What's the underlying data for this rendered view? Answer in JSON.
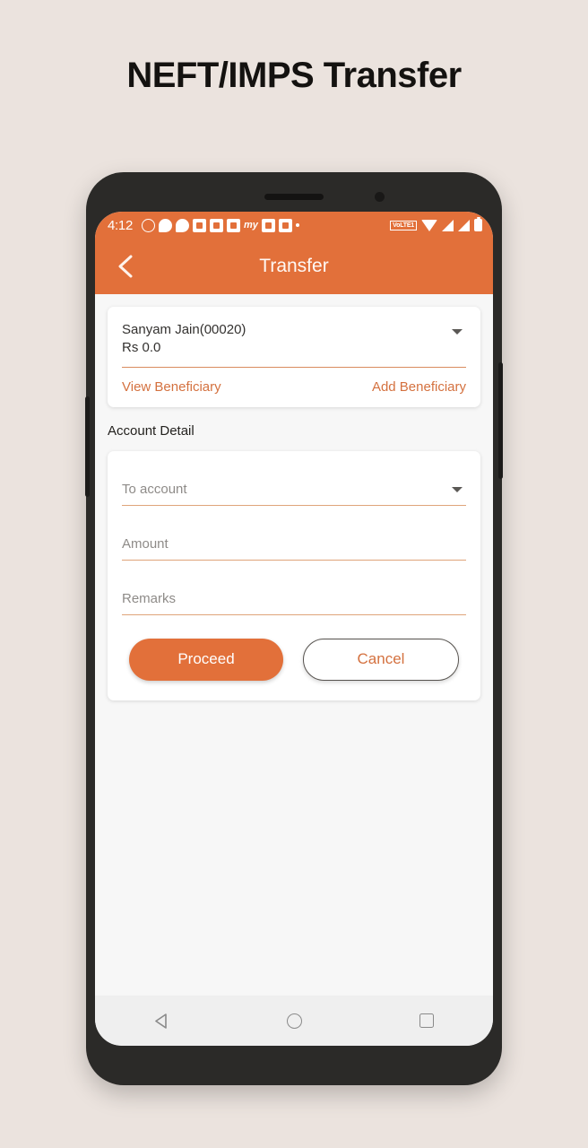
{
  "page": {
    "title": "NEFT/IMPS Transfer",
    "background_color": "#EBE3DE"
  },
  "theme": {
    "accent": "#E2703A",
    "link": "#D4713F",
    "underline": "#DFA47A",
    "screen_bg": "#F7F7F7",
    "card_bg": "#FFFFFF"
  },
  "status_bar": {
    "time": "4:12",
    "notification_icons": [
      "whatsapp-icon",
      "message-bubble-icon",
      "chat-bubble-icon",
      "video-download-icon-1",
      "video-download-icon-2",
      "video-download-icon-3",
      "my-app-icon",
      "photo-app-icon",
      "shield-app-icon",
      "more-dot-icon"
    ],
    "my_app_label": "my",
    "volte_label": "VoLTE1",
    "right_icons": [
      "volte-badge",
      "wifi-icon",
      "signal-icon-1",
      "signal-icon-2",
      "battery-icon"
    ]
  },
  "app_bar": {
    "title": "Transfer",
    "back_icon": "chevron-left-icon"
  },
  "account_card": {
    "account_name": "Sanyam Jain(00020)",
    "balance": "Rs 0.0",
    "dropdown_icon": "caret-down-icon",
    "view_beneficiary": "View Beneficiary",
    "add_beneficiary": "Add Beneficiary"
  },
  "account_detail": {
    "heading": "Account Detail",
    "fields": [
      {
        "name": "to-account",
        "placeholder": "To account",
        "value": "",
        "type": "dropdown"
      },
      {
        "name": "amount",
        "placeholder": "Amount",
        "value": "",
        "type": "text"
      },
      {
        "name": "remarks",
        "placeholder": "Remarks",
        "value": "",
        "type": "text"
      }
    ],
    "proceed_label": "Proceed",
    "cancel_label": "Cancel"
  },
  "nav_bar": {
    "back": "back-triangle-icon",
    "home": "home-circle-icon",
    "recents": "recents-square-icon"
  }
}
